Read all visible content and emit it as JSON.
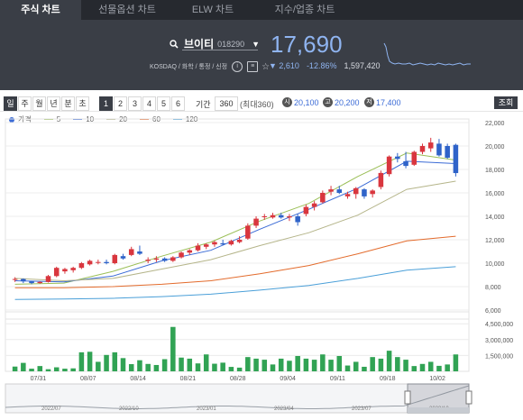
{
  "tabs": [
    {
      "label": "주식 차트",
      "active": true
    },
    {
      "label": "선물옵션 차트",
      "active": false
    },
    {
      "label": "ELW 차트",
      "active": false
    },
    {
      "label": "지수/업종 차트",
      "active": false
    }
  ],
  "stock": {
    "name": "브이티",
    "code": "018290",
    "market_info": "KOSDAQ / 화학 / 통정 / 신정",
    "price": "17,690",
    "change": "▼ 2,610",
    "change_pct": "-12.86%",
    "volume": "1,597,420"
  },
  "colors": {
    "up": "#d9363e",
    "down": "#2f63c9",
    "vol": "#31a354",
    "ma5": "#9bbf57",
    "ma10": "#3b6bd6",
    "ma20": "#b5b58a",
    "ma60": "#e36b2c",
    "ma120": "#4a9fd8"
  },
  "toolbar": {
    "periods": [
      "일",
      "주",
      "월",
      "년",
      "분",
      "초"
    ],
    "counts": [
      "1",
      "2",
      "3",
      "4",
      "5",
      "6"
    ],
    "range_label": "기간",
    "range_value": "360",
    "range_max": "(최대360)",
    "open_icon": "시",
    "open": "20,100",
    "high_icon": "고",
    "high": "20,200",
    "low_icon": "저",
    "low": "17,400",
    "query_button": "조회"
  },
  "legend": [
    {
      "label": "가격",
      "color": "#3b6bd6",
      "dot": true
    },
    {
      "label": "5",
      "color": "#9bbf57"
    },
    {
      "label": "10",
      "color": "#3b6bd6"
    },
    {
      "label": "20",
      "color": "#b5b58a"
    },
    {
      "label": "60",
      "color": "#e36b2c"
    },
    {
      "label": "120",
      "color": "#4a9fd8"
    }
  ],
  "chart_data": {
    "type": "candlestick",
    "x_tick_labels": [
      "07/31",
      "08/07",
      "08/14",
      "08/21",
      "08/28",
      "09/04",
      "09/11",
      "09/18",
      "10/02"
    ],
    "price_ticks": [
      6000,
      8000,
      10000,
      12000,
      14000,
      16000,
      18000,
      20000,
      22000
    ],
    "price_tick_labels": [
      "6,000",
      "8,000",
      "10,000",
      "12,000",
      "14,000",
      "16,000",
      "18,000",
      "20,000",
      "22,000"
    ],
    "ylim": [
      6000,
      22000
    ],
    "volume_ticks": [
      1500000,
      3000000,
      4500000
    ],
    "volume_tick_labels": [
      "1,500,000",
      "3,000,000",
      "4,500,000"
    ],
    "volume_ylim": [
      0,
      5200000
    ],
    "candles": [
      [
        8600,
        8800,
        8400,
        8650
      ],
      [
        8650,
        8700,
        8300,
        8450
      ],
      [
        8450,
        8500,
        8200,
        8300
      ],
      [
        8300,
        8450,
        8250,
        8400
      ],
      [
        8400,
        9000,
        8350,
        8900
      ],
      [
        8900,
        9700,
        8800,
        9600
      ],
      [
        9300,
        9600,
        9100,
        9500
      ],
      [
        9400,
        9700,
        9200,
        9600
      ],
      [
        9600,
        10100,
        9500,
        10000
      ],
      [
        9900,
        10300,
        9800,
        10200
      ],
      [
        10100,
        10300,
        9900,
        10100
      ],
      [
        10100,
        10300,
        9900,
        10000
      ],
      [
        10000,
        10800,
        9900,
        10700
      ],
      [
        10600,
        10800,
        10300,
        10400
      ],
      [
        10700,
        11400,
        10600,
        11200
      ],
      [
        11000,
        11500,
        10700,
        10800
      ],
      [
        10200,
        10500,
        10000,
        10300
      ],
      [
        10300,
        10600,
        10100,
        10400
      ],
      [
        10400,
        10500,
        10100,
        10200
      ],
      [
        10200,
        10600,
        10100,
        10500
      ],
      [
        10500,
        11000,
        10400,
        10900
      ],
      [
        10900,
        11200,
        10700,
        11100
      ],
      [
        11100,
        11700,
        11000,
        11500
      ],
      [
        11400,
        11700,
        11200,
        11600
      ],
      [
        11600,
        11900,
        11400,
        11800
      ],
      [
        11700,
        12000,
        11500,
        11600
      ],
      [
        11600,
        12000,
        11500,
        11900
      ],
      [
        11800,
        12300,
        11700,
        12000
      ],
      [
        12100,
        13400,
        12000,
        13200
      ],
      [
        13200,
        14000,
        13000,
        13800
      ],
      [
        14000,
        14200,
        13700,
        14000
      ],
      [
        13900,
        14300,
        13800,
        14100
      ],
      [
        14100,
        14300,
        13800,
        13900
      ],
      [
        13900,
        14200,
        13600,
        14000
      ],
      [
        14000,
        14200,
        13200,
        13500
      ],
      [
        14200,
        15000,
        14000,
        14800
      ],
      [
        14800,
        15300,
        14500,
        15100
      ],
      [
        15200,
        16200,
        15100,
        16000
      ],
      [
        16100,
        16600,
        15800,
        16300
      ],
      [
        16300,
        16600,
        15900,
        16000
      ],
      [
        15700,
        16100,
        15500,
        15900
      ],
      [
        15900,
        16500,
        15500,
        16400
      ],
      [
        16300,
        16400,
        15500,
        15700
      ],
      [
        15900,
        16300,
        15600,
        16200
      ],
      [
        16500,
        17900,
        16300,
        17700
      ],
      [
        17600,
        19200,
        17400,
        19100
      ],
      [
        19100,
        19400,
        18600,
        18900
      ],
      [
        18700,
        19500,
        18100,
        18300
      ],
      [
        18400,
        19600,
        18300,
        19500
      ],
      [
        19500,
        20200,
        19300,
        20000
      ],
      [
        19800,
        20700,
        19500,
        20300
      ],
      [
        20200,
        20600,
        19100,
        19200
      ],
      [
        20000,
        20200,
        18900,
        19000
      ],
      [
        20100,
        20200,
        17400,
        17690
      ]
    ],
    "volumes": [
      450000,
      800000,
      250000,
      500000,
      200000,
      380000,
      250000,
      280000,
      1800000,
      1850000,
      900000,
      1550000,
      1800000,
      1250000,
      680000,
      1050000,
      700000,
      600000,
      1150000,
      4200000,
      1300000,
      1200000,
      750000,
      1600000,
      720000,
      820000,
      420000,
      350000,
      1350000,
      1200000,
      1100000,
      650000,
      1200000,
      1000000,
      1450000,
      1200000,
      1100000,
      1600000,
      1100000,
      1450000,
      550000,
      900000,
      430000,
      1350000,
      1200000,
      1950000,
      1350000,
      1100000,
      500000,
      700000,
      900000,
      520000,
      650000,
      1597420
    ],
    "ma": {
      "5": {
        "start": [
          8200,
          8300,
          9300,
          10600,
          11800,
          13600,
          15100,
          17400,
          19400
        ],
        "end": 18800
      },
      "10": {
        "start": [
          8500,
          8400,
          8900,
          10200,
          11100,
          12900,
          14600,
          16400,
          18700
        ],
        "end": 18500
      },
      "20": {
        "start": [
          8700,
          8500,
          8700,
          9500,
          10300,
          11500,
          12600,
          14100,
          16300
        ],
        "end": 17000
      },
      "60": {
        "start": [
          7900,
          7900,
          8000,
          8200,
          8500,
          9100,
          9800,
          10800,
          11900
        ],
        "end": 12300
      },
      "120": {
        "start": [
          6900,
          6950,
          7000,
          7150,
          7350,
          7700,
          8100,
          8700,
          9400
        ],
        "end": 9700
      }
    }
  },
  "navigator": {
    "labels": [
      "2022/07",
      "2022/10",
      "2023/01",
      "2023/04",
      "2023/07",
      "2023/10"
    ]
  }
}
